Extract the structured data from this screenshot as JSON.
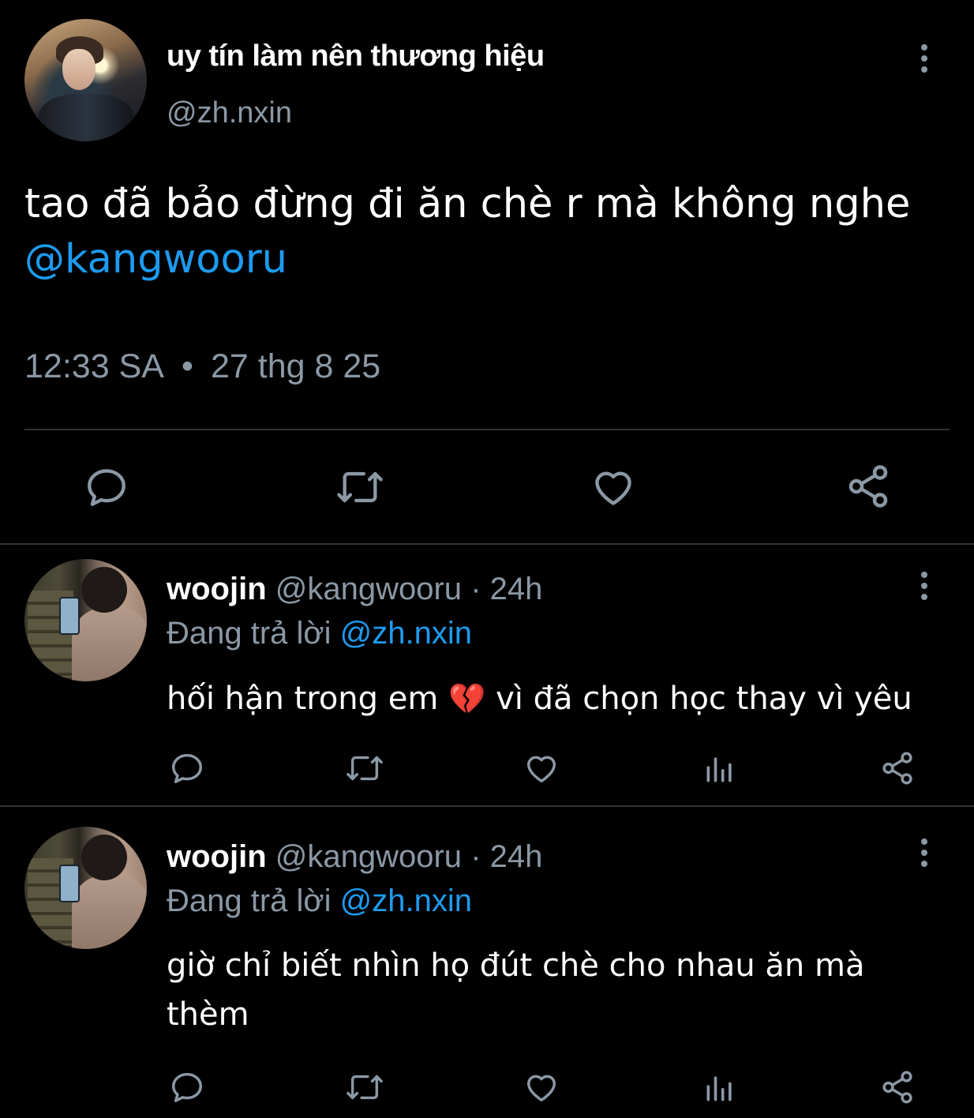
{
  "main_tweet": {
    "display_name": "uy tín làm nên thương hiệu",
    "handle": "@zh.nxin",
    "text": "tao đã bảo đừng đi ăn chè r mà không nghe",
    "mention": "@kangwooru",
    "time": "12:33 SA",
    "separator": "•",
    "date": "27 thg 8 25",
    "actions": [
      "reply-icon",
      "retweet-icon",
      "like-icon",
      "share-icon"
    ]
  },
  "replies": [
    {
      "display_name": "woojin",
      "handle": "@kangwooru",
      "age": "· 24h",
      "replying_prefix": "Đang trả lời",
      "replying_to": "@zh.nxin",
      "text_before_emoji": "hối hận trong em",
      "emoji": "💔",
      "text_after_emoji": "vì đã chọn học thay vì yêu",
      "actions": [
        "reply-icon",
        "retweet-icon",
        "like-icon",
        "views-icon",
        "share-icon"
      ]
    },
    {
      "display_name": "woojin",
      "handle": "@kangwooru",
      "age": "· 24h",
      "replying_prefix": "Đang trả lời",
      "replying_to": "@zh.nxin",
      "text": "giờ chỉ biết nhìn họ đút chè cho nhau ăn mà thèm",
      "actions": [
        "reply-icon",
        "retweet-icon",
        "like-icon",
        "views-icon",
        "share-icon"
      ]
    }
  ],
  "colors": {
    "background": "#000000",
    "text": "#ffffff",
    "secondary": "#8b98a5",
    "link": "#1d9bf0",
    "divider": "#2f3336"
  }
}
